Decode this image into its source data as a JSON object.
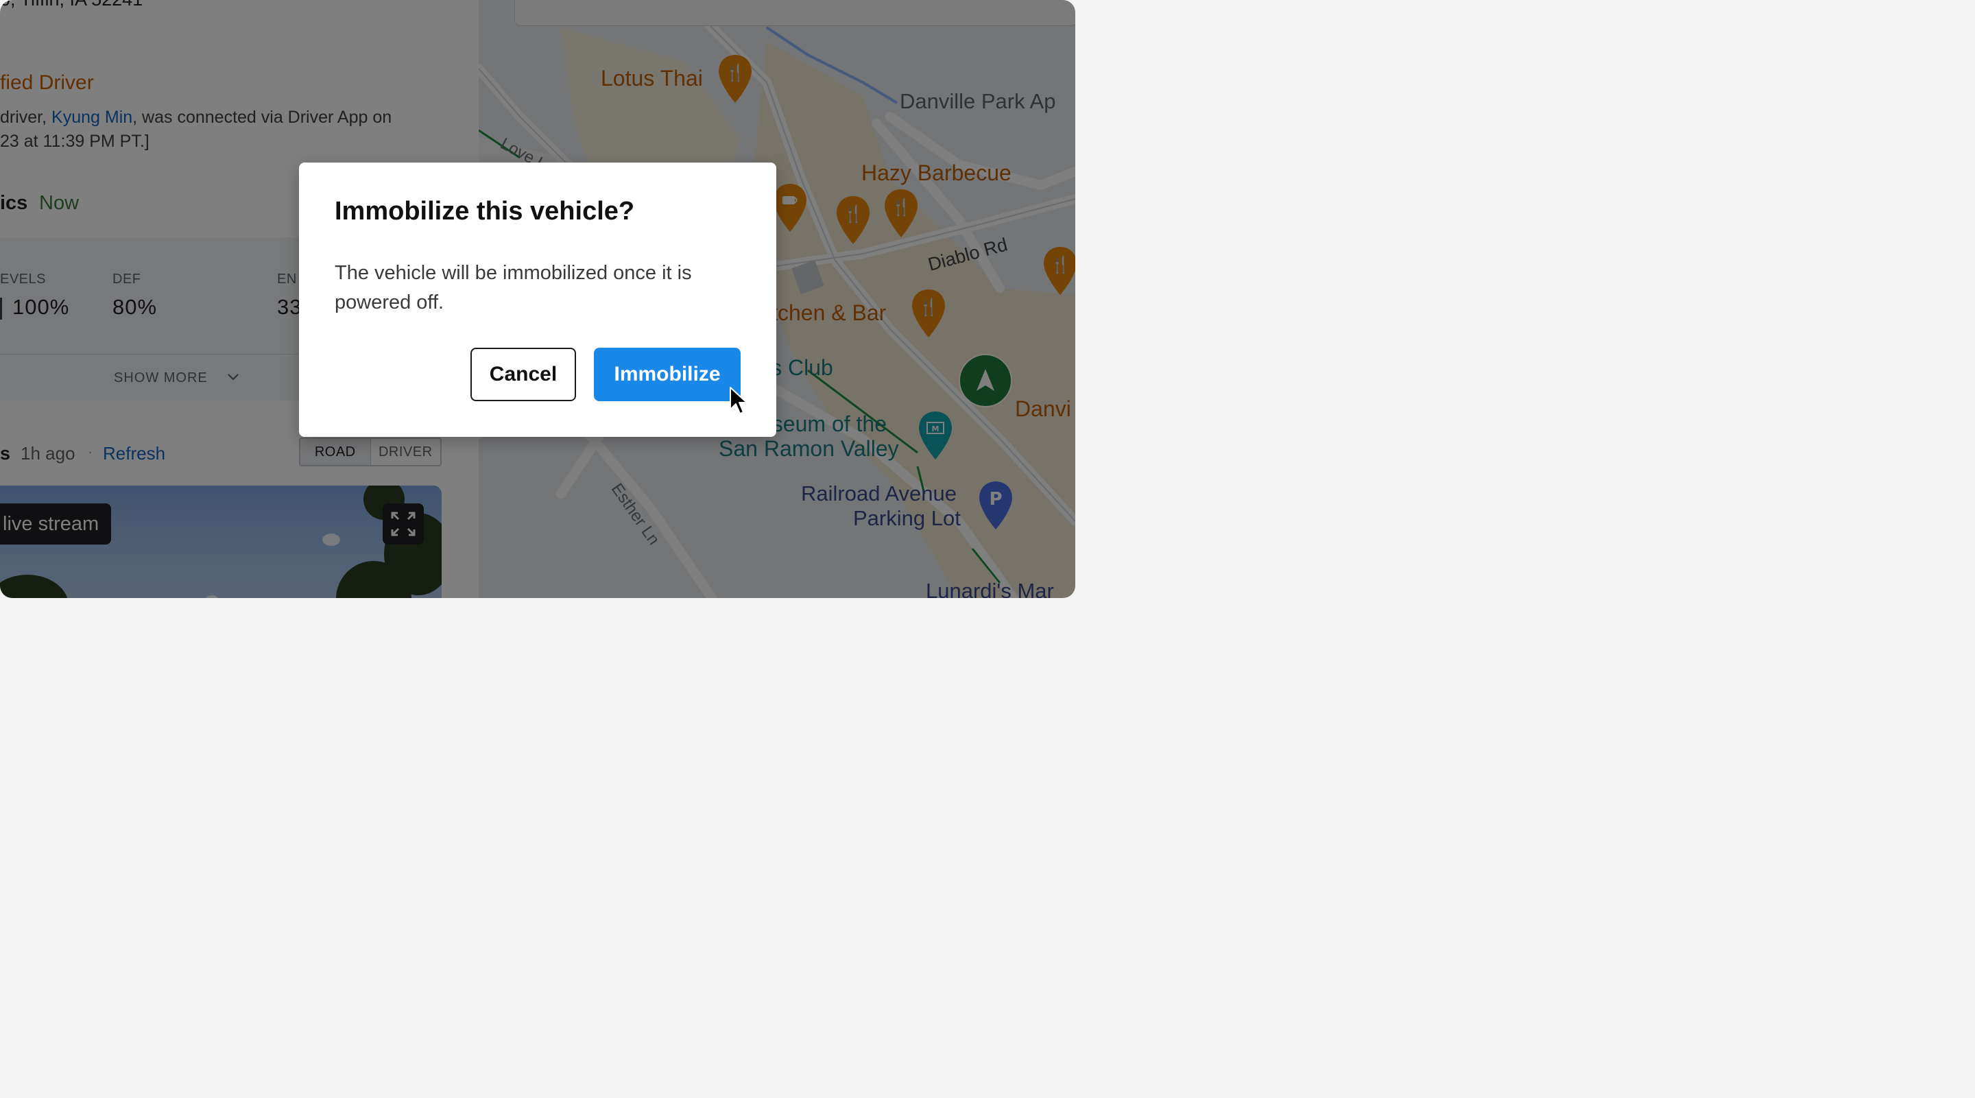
{
  "left_panel": {
    "address": "0, Tiffin, IA 52241",
    "driver_section": {
      "title": "fied Driver",
      "desc_prefix": "driver, ",
      "driver_name": "Kyung Min",
      "desc_suffix": ", was connected via Driver App on",
      "desc_line2": "23 at 11:39 PM PT.]"
    },
    "diagnostics": {
      "title": "ics",
      "status": "Now",
      "metrics": [
        {
          "label": "EVELS",
          "value": "100%"
        },
        {
          "label": "DEF",
          "value": "80%"
        },
        {
          "label": "EN",
          "value": "33"
        }
      ],
      "show_more_label": "SHOW MORE"
    },
    "media": {
      "title": "s",
      "time_ago": "1h ago",
      "separator": "·",
      "refresh_label": "Refresh",
      "toggle": [
        "ROAD",
        "DRIVER"
      ],
      "live_stream_label": "live stream"
    }
  },
  "map": {
    "places": {
      "lotus_thai": "Lotus Thai",
      "danville_park": "Danville Park Ap",
      "hazy_barbecue": "Hazy Barbecue",
      "kitchen_bar": "itchen & Bar",
      "club": "'s Club",
      "museum_line1": "useum of the",
      "museum_line2": "San Ramon Valley",
      "railroad_line1": "Railroad Avenue",
      "railroad_line2": "Parking Lot",
      "lunardi": "Lunardi's Mar",
      "danvi": "Danvi"
    },
    "roads": {
      "love_ln": "Love Ln",
      "diablo_rd": "Diablo Rd",
      "esther_ln": "Esther Ln"
    }
  },
  "dialog": {
    "title": "Immobilize this vehicle?",
    "body": "The vehicle will be immobilized once it is powered off.",
    "cancel_label": "Cancel",
    "confirm_label": "Immobilize"
  },
  "colors": {
    "primary": "#1a88e8",
    "overlay": "rgba(0,0,0,0.5)",
    "map_place": "#c0610a",
    "locator": "#1e7a3a"
  }
}
